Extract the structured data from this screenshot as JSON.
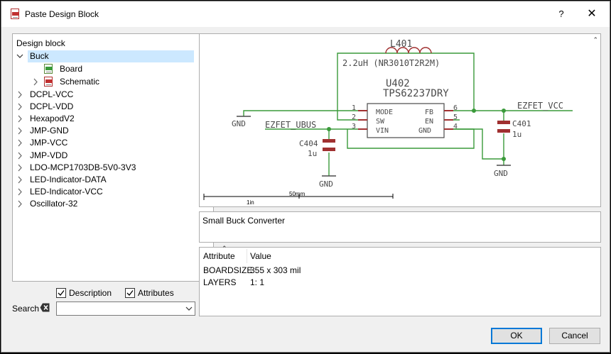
{
  "window": {
    "title": "Paste Design Block",
    "help_label": "?",
    "close_label": "✕"
  },
  "tree": {
    "header": "Design block",
    "selected": {
      "label": "Buck",
      "children": [
        "Board",
        "Schematic"
      ]
    },
    "items": [
      "DCPL-VCC",
      "DCPL-VDD",
      "HexapodV2",
      "JMP-GND",
      "JMP-VCC",
      "JMP-VDD",
      "LDO-MCP1703DB-5V0-3V3",
      "LED-Indicator-DATA",
      "LED-Indicator-VCC",
      "Oscillator-32"
    ]
  },
  "schematic": {
    "inductor": {
      "name": "L401",
      "value": "2.2uH (NR3010T2R2M)"
    },
    "ic": {
      "name": "U402",
      "value": "TPS62237DRY",
      "pins_left": [
        "MODE",
        "SW",
        "VIN"
      ],
      "pins_right": [
        "FB",
        "EN",
        "GND"
      ],
      "pin_numbers_left": [
        "1",
        "2",
        "3"
      ],
      "pin_numbers_right": [
        "6",
        "5",
        "4"
      ]
    },
    "cap_in": {
      "name": "C404",
      "value": "1u"
    },
    "cap_out": {
      "name": "C401",
      "value": "1u"
    },
    "net_in": "EZFET_UBUS",
    "net_out": "EZFET_VCC",
    "gnd_labels": [
      "GND",
      "GND",
      "GND"
    ],
    "scale": {
      "inch": "1in",
      "mm": "50mm"
    }
  },
  "description": "Small Buck Converter",
  "attributes": {
    "columns": [
      "Attribute",
      "Value"
    ],
    "rows": [
      {
        "name": "BOARDSIZE",
        "value": "355 x 303 mil"
      },
      {
        "name": "LAYERS",
        "value": "1: 1"
      }
    ]
  },
  "options": {
    "description_label": "Description",
    "description_checked": true,
    "attributes_label": "Attributes",
    "attributes_checked": true
  },
  "search": {
    "label": "Search",
    "value": ""
  },
  "buttons": {
    "ok": "OK",
    "cancel": "Cancel"
  },
  "colors": {
    "net": "#3a9a3a",
    "part": "#a03030",
    "text": "#4a4a4a",
    "selection": "#cce8ff",
    "default_button": "#0078d7"
  }
}
